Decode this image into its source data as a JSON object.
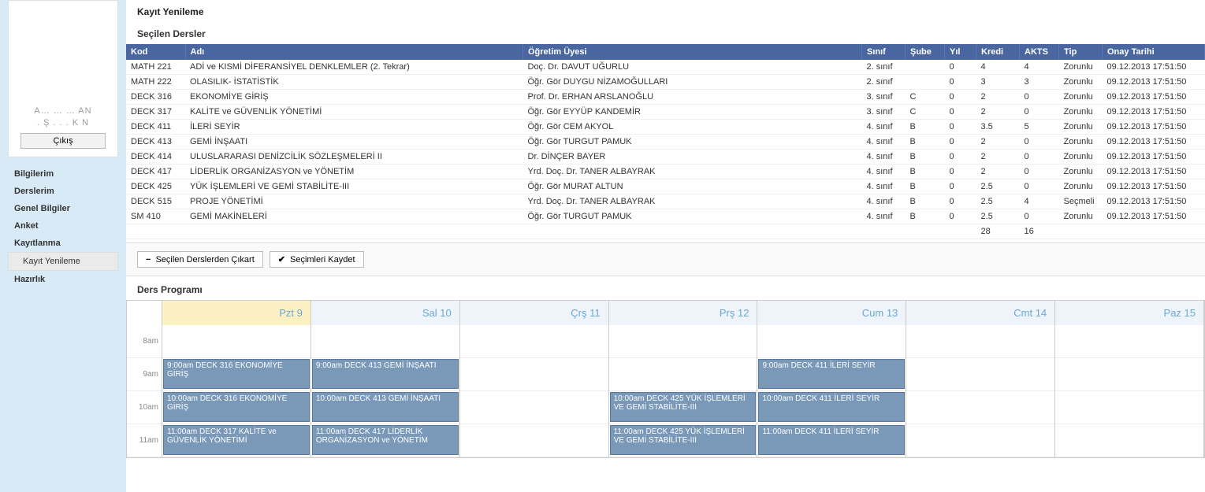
{
  "sidebar": {
    "user_line1": "A… … … AN",
    "user_line2": ". Ş . . . K N",
    "logout": "Çıkış",
    "nav": [
      "Bilgilerim",
      "Derslerim",
      "Genel Bilgiler",
      "Anket",
      "Kayıtlanma"
    ],
    "nav_sub": "Kayıt Yenileme",
    "nav_after": [
      "Hazırlık"
    ]
  },
  "page": {
    "title": "Kayıt Yenileme",
    "section_selected": "Seçilen Dersler",
    "section_schedule": "Ders Programı"
  },
  "table": {
    "headers": [
      "Kod",
      "Adı",
      "Öğretim Üyesi",
      "Sınıf",
      "Şube",
      "Yıl",
      "Kredi",
      "AKTS",
      "Tip",
      "Onay Tarihi"
    ],
    "rows": [
      {
        "kod": "MATH 221",
        "adi": "ADİ ve KISMİ DİFERANSİYEL DENKLEMLER (2. Tekrar)",
        "ogr": "Doç. Dr. DAVUT UĞURLU",
        "sinif": "2. sınıf",
        "sube": "",
        "yil": "0",
        "kredi": "4",
        "akts": "4",
        "tip": "Zorunlu",
        "onay": "09.12.2013 17:51:50"
      },
      {
        "kod": "MATH 222",
        "adi": "OLASILIK- İSTATİSTİK",
        "ogr": "Öğr. Gör DUYGU NİZAMOĞULLARI",
        "sinif": "2. sınıf",
        "sube": "",
        "yil": "0",
        "kredi": "3",
        "akts": "3",
        "tip": "Zorunlu",
        "onay": "09.12.2013 17:51:50"
      },
      {
        "kod": "DECK 316",
        "adi": "EKONOMİYE GİRİŞ",
        "ogr": "Prof. Dr. ERHAN ARSLANOĞLU",
        "sinif": "3. sınıf",
        "sube": "C",
        "yil": "0",
        "kredi": "2",
        "akts": "0",
        "tip": "Zorunlu",
        "onay": "09.12.2013 17:51:50"
      },
      {
        "kod": "DECK 317",
        "adi": "KALİTE ve GÜVENLİK YÖNETİMİ",
        "ogr": "Öğr. Gör EYYÜP KANDEMİR",
        "sinif": "3. sınıf",
        "sube": "C",
        "yil": "0",
        "kredi": "2",
        "akts": "0",
        "tip": "Zorunlu",
        "onay": "09.12.2013 17:51:50"
      },
      {
        "kod": "DECK 411",
        "adi": "İLERİ SEYİR",
        "ogr": "Öğr. Gör CEM AKYOL",
        "sinif": "4. sınıf",
        "sube": "B",
        "yil": "0",
        "kredi": "3.5",
        "akts": "5",
        "tip": "Zorunlu",
        "onay": "09.12.2013 17:51:50"
      },
      {
        "kod": "DECK 413",
        "adi": "GEMİ İNŞAATI",
        "ogr": "Öğr. Gör TURGUT PAMUK",
        "sinif": "4. sınıf",
        "sube": "B",
        "yil": "0",
        "kredi": "2",
        "akts": "0",
        "tip": "Zorunlu",
        "onay": "09.12.2013 17:51:50"
      },
      {
        "kod": "DECK 414",
        "adi": "ULUSLARARASI DENİZCİLİK SÖZLEŞMELERİ II",
        "ogr": "Dr. DİNÇER BAYER",
        "sinif": "4. sınıf",
        "sube": "B",
        "yil": "0",
        "kredi": "2",
        "akts": "0",
        "tip": "Zorunlu",
        "onay": "09.12.2013 17:51:50"
      },
      {
        "kod": "DECK 417",
        "adi": "LİDERLİK ORGANİZASYON ve YÖNETİM",
        "ogr": "Yrd. Doç. Dr. TANER ALBAYRAK",
        "sinif": "4. sınıf",
        "sube": "B",
        "yil": "0",
        "kredi": "2",
        "akts": "0",
        "tip": "Zorunlu",
        "onay": "09.12.2013 17:51:50"
      },
      {
        "kod": "DECK 425",
        "adi": "YÜK İŞLEMLERİ VE GEMİ STABİLİTE-III",
        "ogr": "Öğr. Gör MURAT ALTUN",
        "sinif": "4. sınıf",
        "sube": "B",
        "yil": "0",
        "kredi": "2.5",
        "akts": "0",
        "tip": "Zorunlu",
        "onay": "09.12.2013 17:51:50"
      },
      {
        "kod": "DECK 515",
        "adi": "PROJE YÖNETİMİ",
        "ogr": "Yrd. Doç. Dr. TANER ALBAYRAK",
        "sinif": "4. sınıf",
        "sube": "B",
        "yil": "0",
        "kredi": "2.5",
        "akts": "4",
        "tip": "Seçmeli",
        "onay": "09.12.2013 17:51:50"
      },
      {
        "kod": "SM 410",
        "adi": "GEMİ MAKİNELERİ",
        "ogr": "Öğr. Gör TURGUT PAMUK",
        "sinif": "4. sınıf",
        "sube": "B",
        "yil": "0",
        "kredi": "2.5",
        "akts": "0",
        "tip": "Zorunlu",
        "onay": "09.12.2013 17:51:50"
      }
    ],
    "total_kredi": "28",
    "total_akts": "16"
  },
  "actions": {
    "remove": "Seçilen Derslerden Çıkart",
    "save": "Seçimleri Kaydet"
  },
  "calendar": {
    "days": [
      "Pzt 9",
      "Sal 10",
      "Çrş 11",
      "Prş 12",
      "Cum 13",
      "Cmt 14",
      "Paz 15"
    ],
    "today_index": 0,
    "times": [
      "8am",
      "9am",
      "10am",
      "11am"
    ],
    "events": [
      {
        "day": 0,
        "slot": 1,
        "text": "9:00am DECK 316 EKONOMİYE GİRİŞ"
      },
      {
        "day": 0,
        "slot": 2,
        "text": "10:00am DECK 316 EKONOMİYE GİRİŞ"
      },
      {
        "day": 0,
        "slot": 3,
        "text": "11:00am DECK 317 KALİTE ve GÜVENLİK YÖNETİMİ"
      },
      {
        "day": 1,
        "slot": 1,
        "text": "9:00am DECK 413 GEMİ İNŞAATI"
      },
      {
        "day": 1,
        "slot": 2,
        "text": "10:00am DECK 413 GEMİ İNŞAATI"
      },
      {
        "day": 1,
        "slot": 3,
        "text": "11:00am DECK 417 LİDERLİK ORGANİZASYON ve YÖNETİM"
      },
      {
        "day": 3,
        "slot": 2,
        "text": "10:00am DECK 425 YÜK İŞLEMLERİ VE GEMİ STABİLİTE-III"
      },
      {
        "day": 3,
        "slot": 3,
        "text": "11:00am DECK 425 YÜK İŞLEMLERİ VE GEMİ STABİLİTE-III"
      },
      {
        "day": 4,
        "slot": 1,
        "text": "9:00am DECK 411 İLERİ SEYİR"
      },
      {
        "day": 4,
        "slot": 2,
        "text": "10:00am DECK 411 İLERİ SEYİR"
      },
      {
        "day": 4,
        "slot": 3,
        "text": "11:00am DECK 411 İLERİ SEYİR"
      }
    ]
  }
}
